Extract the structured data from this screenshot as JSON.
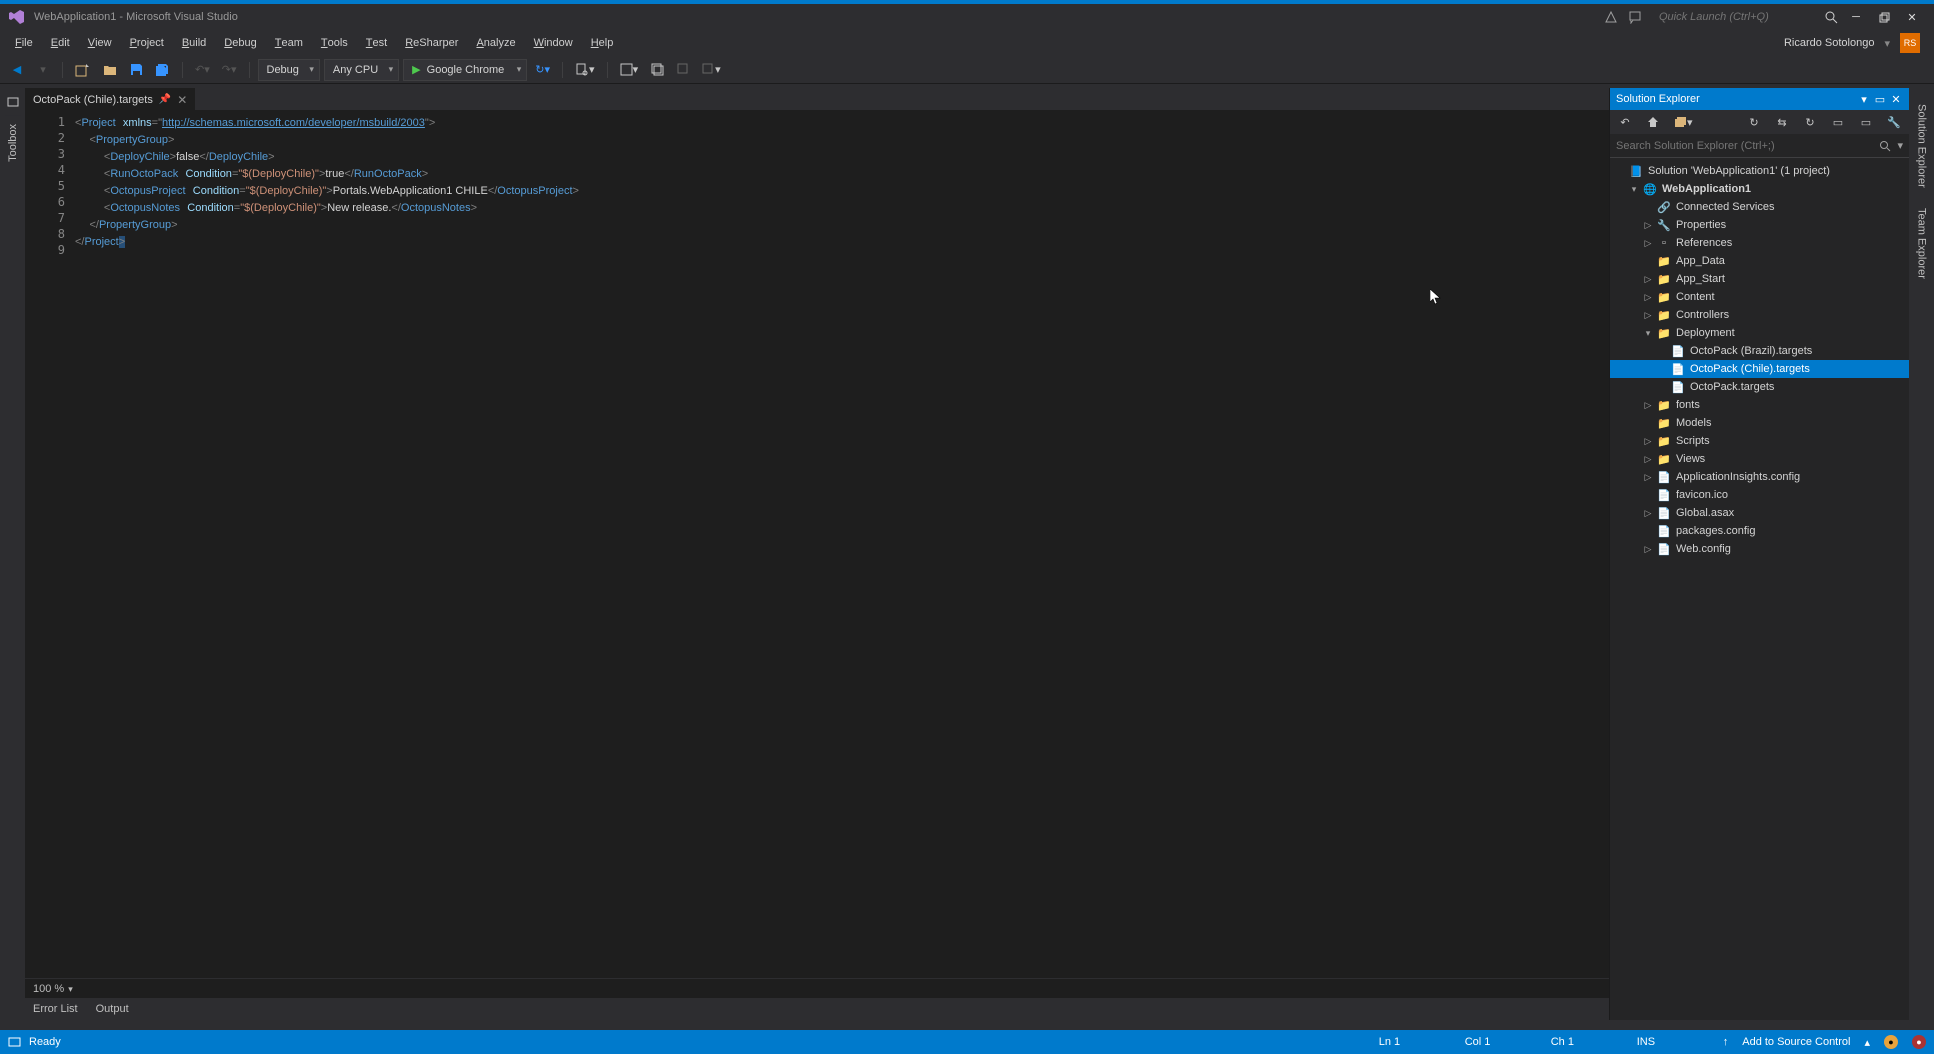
{
  "title": "WebApplication1 - Microsoft Visual Studio",
  "quicklaunch_placeholder": "Quick Launch (Ctrl+Q)",
  "menus": [
    "File",
    "Edit",
    "View",
    "Project",
    "Build",
    "Debug",
    "Team",
    "Tools",
    "Test",
    "ReSharper",
    "Analyze",
    "Window",
    "Help"
  ],
  "user": {
    "name": "Ricardo Sotolongo",
    "initials": "RS"
  },
  "toolbar": {
    "config": "Debug",
    "platform": "Any CPU",
    "start": "Google Chrome"
  },
  "tab": {
    "name": "OctoPack (Chile).targets"
  },
  "code_lines": [
    {
      "n": 1,
      "html": "<span class='t-gray'>&lt;</span><span class='t-blue'>Project</span> <span class='t-attr'>xmlns</span><span class='t-gray'>=</span><span class='t-gray'>\"</span><span class='t-link'>http://schemas.microsoft.com/developer/msbuild/2003</span><span class='t-gray'>\"</span><span class='t-gray'>&gt;</span>"
    },
    {
      "n": 2,
      "html": "  <span class='t-gray'>&lt;</span><span class='t-blue'>PropertyGroup</span><span class='t-gray'>&gt;</span>"
    },
    {
      "n": 3,
      "html": "    <span class='t-gray'>&lt;</span><span class='t-blue'>DeployChile</span><span class='t-gray'>&gt;</span><span class='t-text'>false</span><span class='t-gray'>&lt;/</span><span class='t-blue'>DeployChile</span><span class='t-gray'>&gt;</span>"
    },
    {
      "n": 4,
      "html": "    <span class='t-gray'>&lt;</span><span class='t-blue'>RunOctoPack</span> <span class='t-attr'>Condition</span><span class='t-gray'>=</span><span class='t-red'>\"$(DeployChile)\"</span><span class='t-gray'>&gt;</span><span class='t-text'>true</span><span class='t-gray'>&lt;/</span><span class='t-blue'>RunOctoPack</span><span class='t-gray'>&gt;</span>"
    },
    {
      "n": 5,
      "html": "    <span class='t-gray'>&lt;</span><span class='t-blue'>OctopusProject</span> <span class='t-attr'>Condition</span><span class='t-gray'>=</span><span class='t-red'>\"$(DeployChile)\"</span><span class='t-gray'>&gt;</span><span class='t-text'>Portals.WebApplication1 CHILE</span><span class='t-gray'>&lt;/</span><span class='t-blue'>OctopusProject</span><span class='t-gray'>&gt;</span>"
    },
    {
      "n": 6,
      "html": "    <span class='t-gray'>&lt;</span><span class='t-blue'>OctopusNotes</span> <span class='t-attr'>Condition</span><span class='t-gray'>=</span><span class='t-red'>\"$(DeployChile)\"</span><span class='t-gray'>&gt;</span><span class='t-text'>New release.</span><span class='t-gray'>&lt;/</span><span class='t-blue'>OctopusNotes</span><span class='t-gray'>&gt;</span>"
    },
    {
      "n": 7,
      "html": "  <span class='t-gray'>&lt;/</span><span class='t-blue'>PropertyGroup</span><span class='t-gray'>&gt;</span>"
    },
    {
      "n": 8,
      "html": "<span class='t-gray'>&lt;/</span><span class='t-blue'>Project</span><span class='t-gray' style='background:#264f78'>&gt;</span>"
    },
    {
      "n": 9,
      "html": ""
    }
  ],
  "zoom": "100 %",
  "bottom_tabs": [
    "Error List",
    "Output"
  ],
  "solution": {
    "title": "Solution Explorer",
    "search_placeholder": "Search Solution Explorer (Ctrl+;)",
    "root": "Solution 'WebApplication1' (1 project)",
    "project": "WebApplication1",
    "nodes": [
      {
        "ind": 2,
        "exp": "",
        "ic": "🔗",
        "lbl": "Connected Services"
      },
      {
        "ind": 2,
        "exp": "▷",
        "ic": "🔧",
        "lbl": "Properties"
      },
      {
        "ind": 2,
        "exp": "▷",
        "ic": "▫",
        "lbl": "References"
      },
      {
        "ind": 2,
        "exp": "",
        "ic": "📁",
        "lbl": "App_Data"
      },
      {
        "ind": 2,
        "exp": "▷",
        "ic": "📁",
        "lbl": "App_Start"
      },
      {
        "ind": 2,
        "exp": "▷",
        "ic": "📁",
        "lbl": "Content"
      },
      {
        "ind": 2,
        "exp": "▷",
        "ic": "📁",
        "lbl": "Controllers"
      },
      {
        "ind": 2,
        "exp": "▾",
        "ic": "📁",
        "lbl": "Deployment"
      },
      {
        "ind": 3,
        "exp": "",
        "ic": "📄",
        "lbl": "OctoPack (Brazil).targets"
      },
      {
        "ind": 3,
        "exp": "",
        "ic": "📄",
        "lbl": "OctoPack (Chile).targets",
        "sel": true
      },
      {
        "ind": 3,
        "exp": "",
        "ic": "📄",
        "lbl": "OctoPack.targets"
      },
      {
        "ind": 2,
        "exp": "▷",
        "ic": "📁",
        "lbl": "fonts"
      },
      {
        "ind": 2,
        "exp": "",
        "ic": "📁",
        "lbl": "Models"
      },
      {
        "ind": 2,
        "exp": "▷",
        "ic": "📁",
        "lbl": "Scripts"
      },
      {
        "ind": 2,
        "exp": "▷",
        "ic": "📁",
        "lbl": "Views"
      },
      {
        "ind": 2,
        "exp": "▷",
        "ic": "📄",
        "lbl": "ApplicationInsights.config"
      },
      {
        "ind": 2,
        "exp": "",
        "ic": "📄",
        "lbl": "favicon.ico"
      },
      {
        "ind": 2,
        "exp": "▷",
        "ic": "📄",
        "lbl": "Global.asax"
      },
      {
        "ind": 2,
        "exp": "",
        "ic": "📄",
        "lbl": "packages.config"
      },
      {
        "ind": 2,
        "exp": "▷",
        "ic": "📄",
        "lbl": "Web.config"
      }
    ]
  },
  "rails": {
    "left": "Toolbox",
    "right1": "Solution Explorer",
    "right2": "Team Explorer"
  },
  "status": {
    "ready": "Ready",
    "ln": "Ln 1",
    "col": "Col 1",
    "ch": "Ch 1",
    "ins": "INS",
    "source_control": "Add to Source Control"
  }
}
